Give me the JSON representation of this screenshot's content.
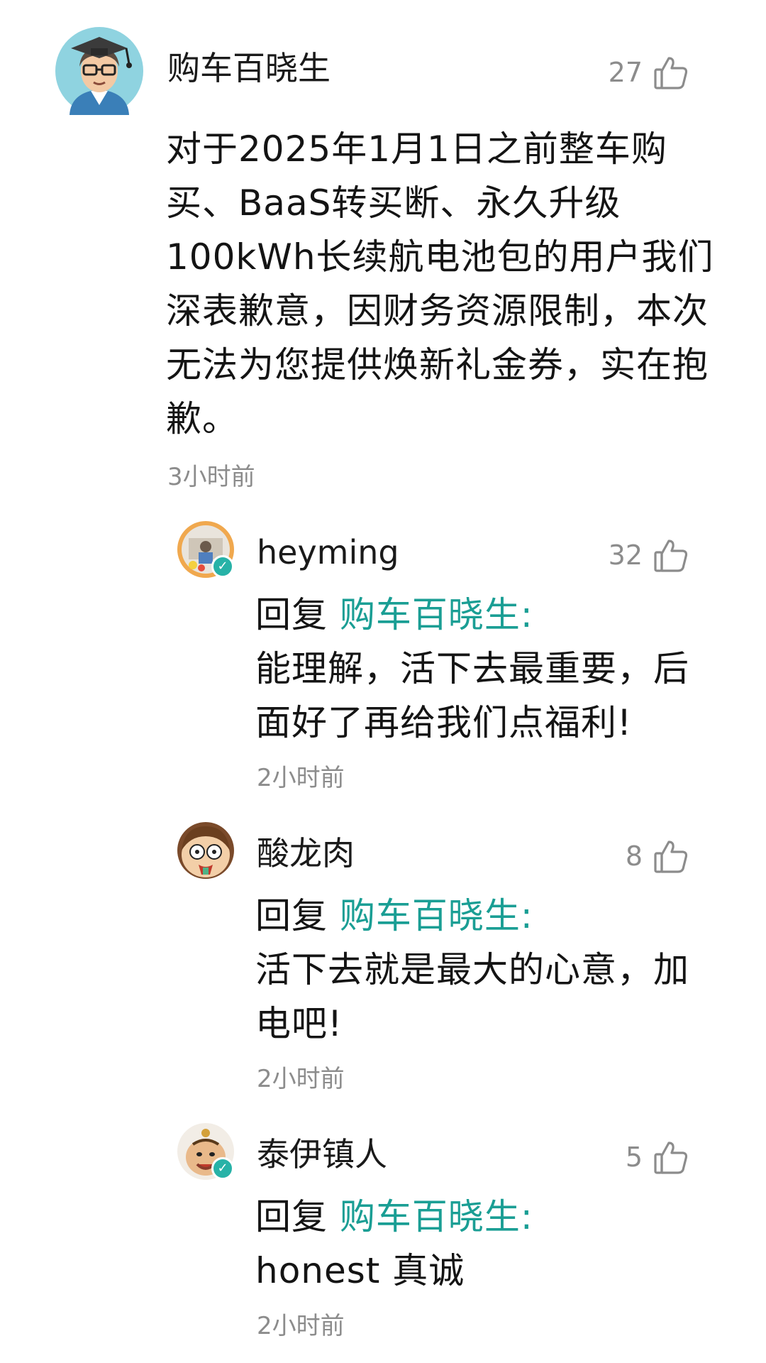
{
  "main_comment": {
    "username": "购车百晓生",
    "likes": "27",
    "lines": [
      "对于2025年1月1日之前整车购",
      "买、BaaS转买断、永久升级",
      "100kWh长续航电池包的用户我们",
      "深表歉意，因财务资源限制，本次",
      "无法为您提供焕新礼金券，实在抱",
      "歉。"
    ],
    "timestamp": "3小时前"
  },
  "replies": [
    {
      "username": "heyming",
      "likes": "32",
      "reply_prefix": "回复 ",
      "reply_target": "购车百晓生:",
      "lines": [
        "能理解，活下去最重要，后",
        "面好了再给我们点福利!"
      ],
      "timestamp": "2小时前",
      "verified": true
    },
    {
      "username": "酸龙肉",
      "likes": "8",
      "reply_prefix": "回复 ",
      "reply_target": "购车百晓生:",
      "lines": [
        "活下去就是最大的心意，加",
        "电吧!"
      ],
      "timestamp": "2小时前",
      "verified": false
    },
    {
      "username": "泰伊镇人",
      "likes": "5",
      "reply_prefix": "回复 ",
      "reply_target": "购车百晓生:",
      "lines": [
        "honest 真诚"
      ],
      "timestamp": "2小时前",
      "verified": true
    }
  ],
  "icons": {
    "like": "thumbs-up-icon",
    "verified": "verified-badge-icon"
  },
  "colors": {
    "mention": "#1a9e94",
    "meta_text": "#8c8c8c",
    "verified_badge": "#27b2a7"
  }
}
